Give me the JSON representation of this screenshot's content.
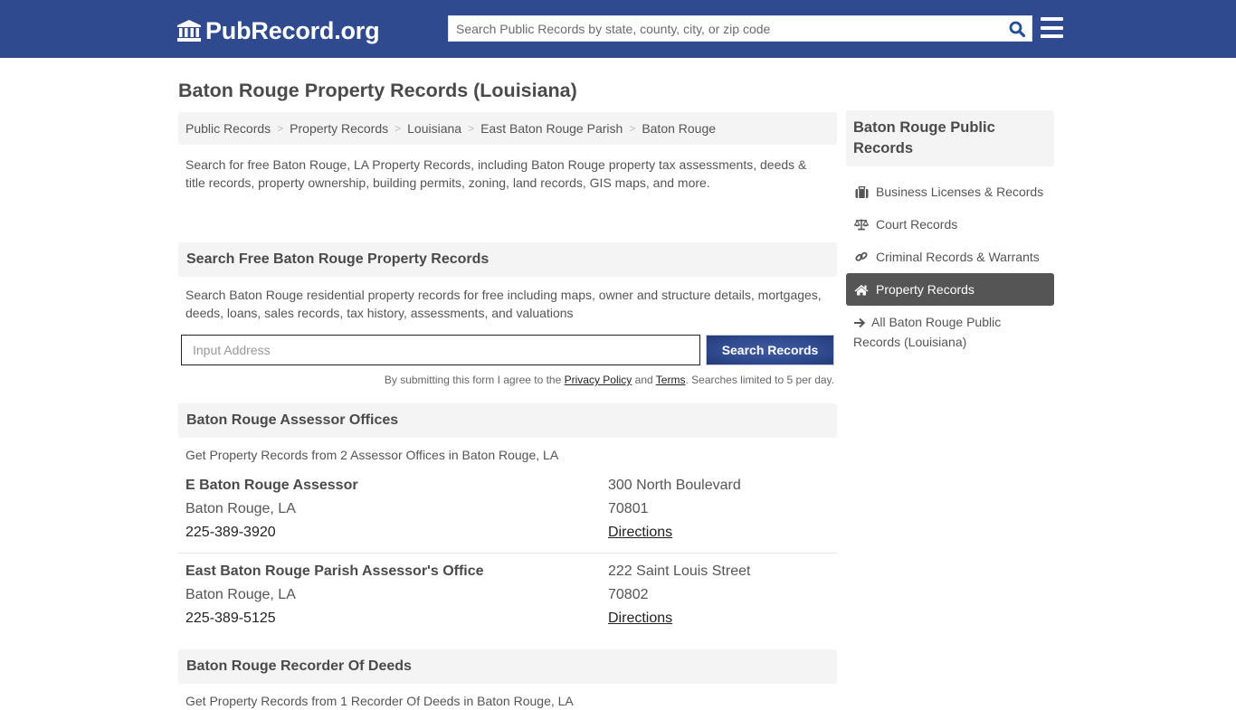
{
  "header": {
    "logo_text": "PubRecord.org",
    "search_placeholder": "Search Public Records by state, county, city, or zip code",
    "colors": {
      "nav_bg": "#2f4a8e",
      "search_icon": "#1f4e9a"
    }
  },
  "page": {
    "title": "Baton Rouge Property Records (Louisiana)"
  },
  "breadcrumb": [
    "Public Records",
    "Property Records",
    "Louisiana",
    "East Baton Rouge Parish",
    "Baton Rouge"
  ],
  "breadcrumb_separator": ">",
  "intro": "Search for free Baton Rouge, LA Property Records, including Baton Rouge property tax assessments, deeds & title records, property ownership, building permits, zoning, land records, GIS maps, and more.",
  "search_section": {
    "heading": "Search Free Baton Rouge Property Records",
    "description": "Search Baton Rouge residential property records for free including maps, owner and structure details, mortgages, deeds, loans, sales records, tax history, assessments, and valuations",
    "input_placeholder": "Input Address",
    "input_value": "",
    "button_label": "Search Records",
    "disclaimer_prefix": "By submitting this form I agree to the ",
    "privacy_link": "Privacy Policy",
    "disclaimer_and": " and ",
    "terms_link": "Terms",
    "disclaimer_suffix": ". Searches limited to 5 per day."
  },
  "assessor_section": {
    "heading": "Baton Rouge Assessor Offices",
    "description": "Get Property Records from 2 Assessor Offices in Baton Rouge, LA",
    "offices": [
      {
        "name": "E Baton Rouge Assessor",
        "city": "Baton Rouge, LA",
        "phone": "225-389-3920",
        "address": "300 North Boulevard",
        "zip": "70801",
        "directions_label": "Directions"
      },
      {
        "name": "East Baton Rouge Parish Assessor's Office",
        "city": "Baton Rouge, LA",
        "phone": "225-389-5125",
        "address": "222 Saint Louis Street",
        "zip": "70802",
        "directions_label": "Directions"
      }
    ]
  },
  "recorder_section": {
    "heading": "Baton Rouge Recorder Of Deeds",
    "description": "Get Property Records from 1 Recorder Of Deeds in Baton Rouge, LA"
  },
  "sidebar": {
    "heading": "Baton Rouge Public Records",
    "items": [
      {
        "label": "Business Licenses & Records",
        "icon": "briefcase-icon",
        "active": false
      },
      {
        "label": "Court Records",
        "icon": "balance-scale-icon",
        "active": false
      },
      {
        "label": "Criminal Records & Warrants",
        "icon": "link-icon",
        "active": false
      },
      {
        "label": "Property Records",
        "icon": "home-icon",
        "active": true
      }
    ],
    "all_link": "All Baton Rouge Public Records (Louisiana)",
    "all_link_icon": "arrow-right-icon"
  }
}
